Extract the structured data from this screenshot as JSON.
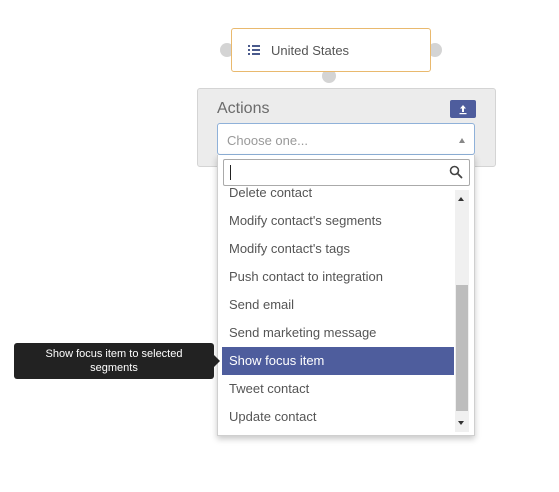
{
  "node": {
    "label": "United States",
    "icon": "list-icon",
    "border_color": "#e9b96e"
  },
  "actions_panel": {
    "title": "Actions",
    "upload_icon": "upload-arrow-icon",
    "button_color": "#4e5d9d"
  },
  "select": {
    "placeholder": "Choose one...",
    "search_value": "",
    "search_icon": "search-icon"
  },
  "options": [
    {
      "label": "Delete contact"
    },
    {
      "label": "Modify contact's segments"
    },
    {
      "label": "Modify contact's tags"
    },
    {
      "label": "Push contact to integration"
    },
    {
      "label": "Send email"
    },
    {
      "label": "Send marketing message"
    },
    {
      "label": "Show focus item"
    },
    {
      "label": "Tweet contact"
    },
    {
      "label": "Update contact"
    }
  ],
  "highlighted_option": "Show focus item",
  "highlight_color": "#4e5d9d",
  "tooltip": {
    "line1": "Show focus item to selected",
    "line2": "segments"
  }
}
